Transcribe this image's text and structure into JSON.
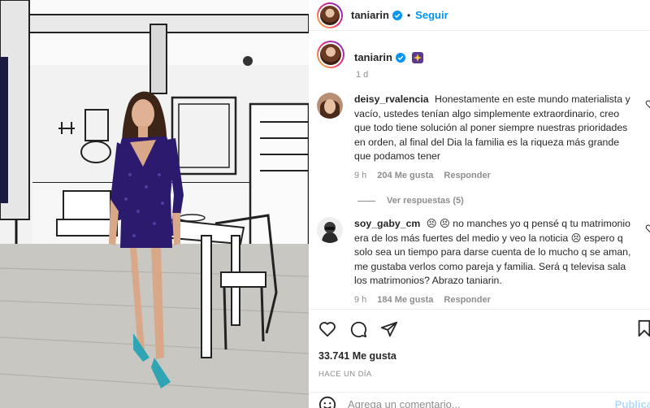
{
  "post": {
    "username": "taniarin",
    "follow_label": "Seguir",
    "caption_time": "1 d",
    "likes": "33.741 Me gusta",
    "posted": "HACE UN DÍA"
  },
  "comments": [
    {
      "user": "deisy_rvalencia",
      "text": "Honestamente en este mundo materialista y vacío, ustedes tenían algo simplemente extraordinario, creo que todo tiene solución al poner siempre nuestras prioridades en orden, al final del Dia la familia es la riqueza más grande que podamos tener",
      "time": "9 h",
      "likes": "204 Me gusta",
      "reply": "Responder",
      "view_replies": "Ver respuestas (5)"
    },
    {
      "user": "soy_gaby_cm",
      "text_parts": [
        "😣 😣 no manches yo q pensé q tu matrimonio era de los más fuertes del medio y veo la noticia 😣 espero q solo sea un tiempo para darse cuenta de lo mucho q se aman, me gustaba verlos como pareja y familia. Será q televisa sala los matrimonios? Abrazo taniarin."
      ],
      "time": "9 h",
      "likes": "184 Me gusta",
      "reply": "Responder"
    }
  ],
  "add_comment": {
    "placeholder": "Agrega un comentario...",
    "publish": "Publicar"
  },
  "icons": {
    "like": "heart-icon",
    "comment": "comment-icon",
    "share": "share-icon",
    "save": "bookmark-icon",
    "emoji": "emoji-icon",
    "verified": "verified-badge-icon",
    "caption_emoji": "sparkle-emoji-icon"
  },
  "colors": {
    "accent": "#0095f6",
    "dress": "#2b1a6e",
    "muted": "#8e8e8e"
  }
}
